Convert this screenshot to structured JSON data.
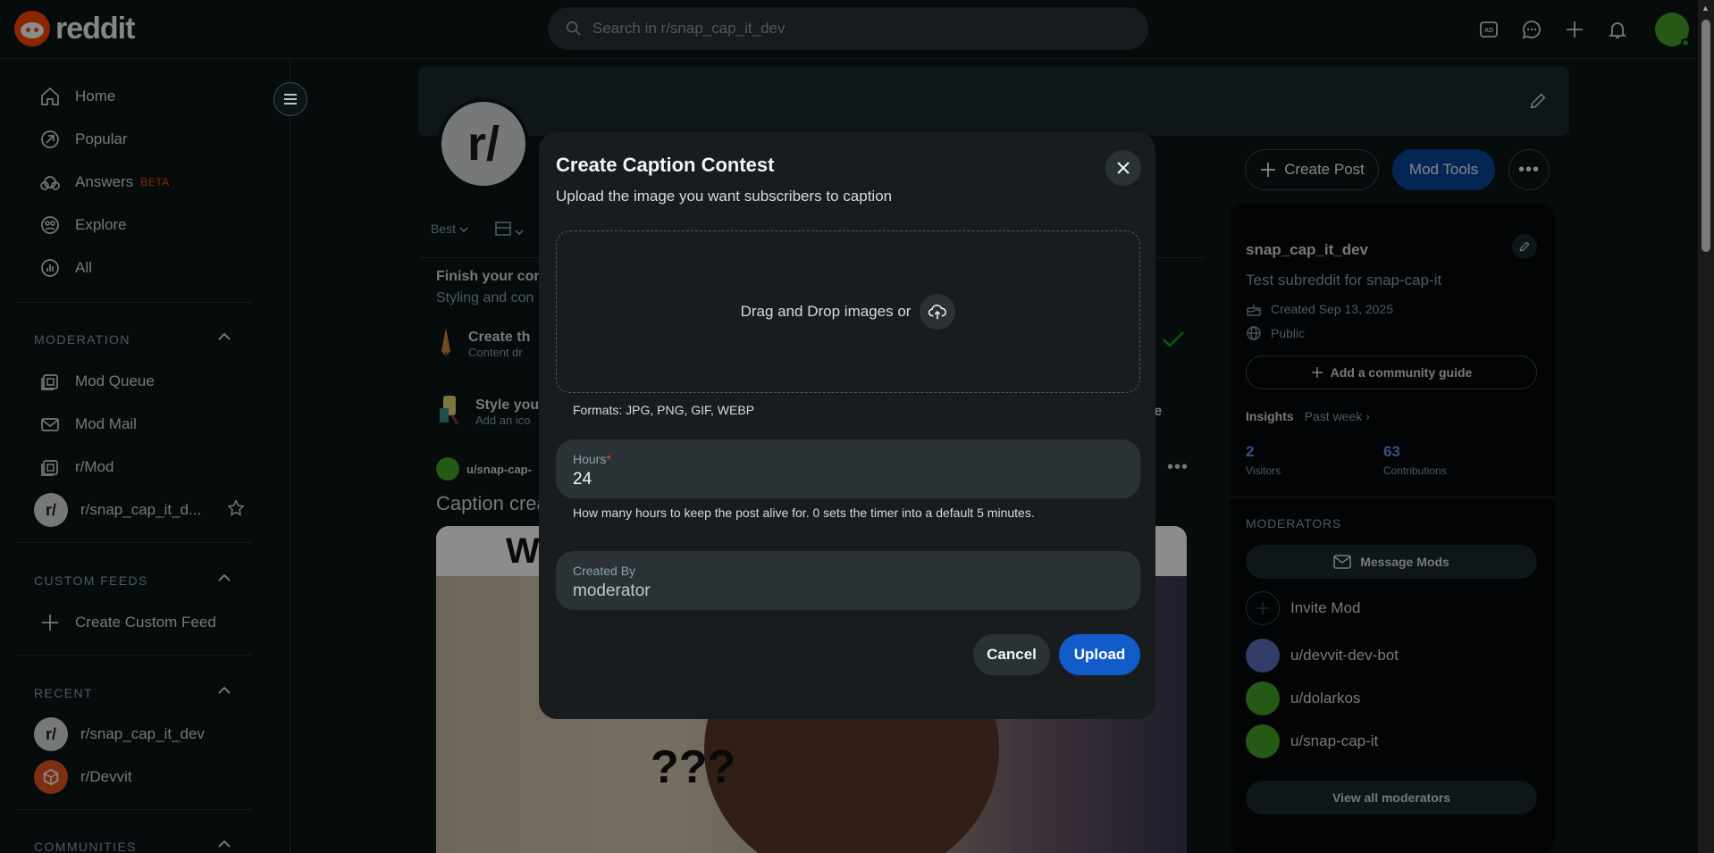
{
  "header": {
    "logo_text": "reddit",
    "search_placeholder": "Search in r/snap_cap_it_dev",
    "icons": [
      "advertise-icon",
      "chat-icon",
      "create-icon",
      "notification-icon",
      "user-avatar"
    ]
  },
  "sidebar": {
    "nav": [
      {
        "label": "Home",
        "icon": "home-icon"
      },
      {
        "label": "Popular",
        "icon": "popular-icon"
      },
      {
        "label": "Answers",
        "icon": "answers-icon",
        "badge": "BETA"
      },
      {
        "label": "Explore",
        "icon": "explore-icon"
      },
      {
        "label": "All",
        "icon": "all-icon"
      }
    ],
    "moderation_title": "MODERATION",
    "moderation": [
      {
        "label": "Mod Queue",
        "icon": "mod-queue-icon"
      },
      {
        "label": "Mod Mail",
        "icon": "mod-mail-icon"
      },
      {
        "label": "r/Mod",
        "icon": "r-mod-icon"
      },
      {
        "label": "r/snap_cap_it_d..."
      }
    ],
    "custom_feeds_title": "CUSTOM FEEDS",
    "create_custom_feed": "Create Custom Feed",
    "recent_title": "RECENT",
    "recent": [
      {
        "label": "r/snap_cap_it_dev"
      },
      {
        "label": "r/Devvit"
      }
    ],
    "communities_title": "COMMUNITIES"
  },
  "main": {
    "sub_avatar_text": "r/",
    "sort_label": "Best",
    "finish_title": "Finish your com",
    "finish_sub": "Styling and con",
    "task1_title": "Create th",
    "task1_sub": "Content dr",
    "task2_title": "Style you",
    "task2_sub": "Add an ico",
    "task2_tail": "yle",
    "post_user": "u/snap-cap-",
    "post_title": "Caption crea",
    "post_image_top": "W",
    "post_image_q": "???"
  },
  "right": {
    "create_post": "Create Post",
    "mod_tools": "Mod Tools",
    "name": "snap_cap_it_dev",
    "description": "Test subreddit for snap-cap-it",
    "created": "Created Sep 13, 2025",
    "visibility": "Public",
    "add_guide": "Add a community guide",
    "insights": "Insights",
    "insights_period": "Past week",
    "visitors_value": "2",
    "visitors_label": "Visitors",
    "contributions_value": "63",
    "contributions_label": "Contributions",
    "moderators_title": "MODERATORS",
    "message_mods": "Message Mods",
    "invite_mod": "Invite Mod",
    "mods": [
      "u/devvit-dev-bot",
      "u/dolarkos",
      "u/snap-cap-it"
    ],
    "view_all": "View all moderators"
  },
  "modal": {
    "title": "Create Caption Contest",
    "subtitle": "Upload the image you want subscribers to caption",
    "dropzone_text": "Drag and Drop images or",
    "formats": "Formats: JPG, PNG, GIF, WEBP",
    "hours_label": "Hours",
    "hours_required": "*",
    "hours_value": "24",
    "hours_help": "How many hours to keep the post alive for. 0 sets the timer into a default 5 minutes.",
    "created_by_label": "Created By",
    "created_by_value": "moderator",
    "cancel": "Cancel",
    "upload": "Upload"
  },
  "colors": {
    "background": "#0b1416",
    "accent_blue": "#115bca",
    "mod_tools_blue": "#0a449b",
    "reddit_orange": "#ff4500",
    "modal_bg": "#181c1f"
  }
}
